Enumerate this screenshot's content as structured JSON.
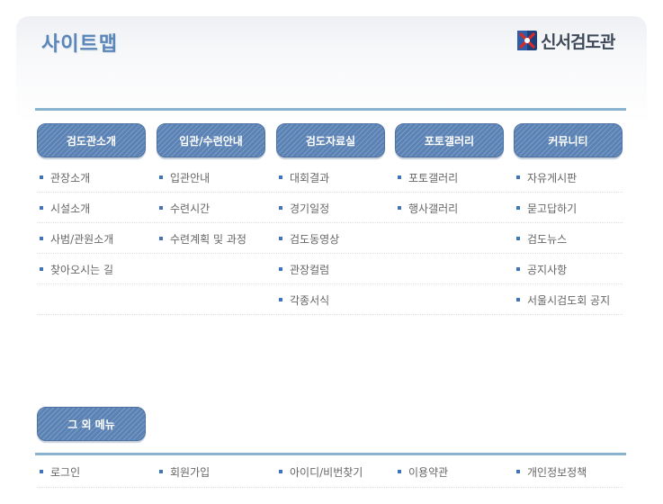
{
  "header": {
    "title": "사이트맵",
    "logo_text": "신서검도관",
    "logo_icon": "sinseo-emblem-icon"
  },
  "colors": {
    "accent": "#5b82b4",
    "title": "#5a86b8",
    "divider": "#8ab3cf",
    "bullet": "#3f74b8"
  },
  "categories": [
    {
      "label": "검도관소개",
      "items": [
        "관장소개",
        "시설소개",
        "사범/관원소개",
        "찾아오시는 길"
      ]
    },
    {
      "label": "입관/수련안내",
      "items": [
        "입관안내",
        "수련시간",
        "수련계획 및 과정"
      ]
    },
    {
      "label": "검도자료실",
      "items": [
        "대회결과",
        "경기일정",
        "검도동영상",
        "관장컬럼",
        "각종서식"
      ]
    },
    {
      "label": "포토갤러리",
      "items": [
        "포토갤러리",
        "행사갤러리"
      ]
    },
    {
      "label": "커뮤니티",
      "items": [
        "자유게시판",
        "묻고답하기",
        "검도뉴스",
        "공지사항",
        "서울시검도회 공지"
      ]
    }
  ],
  "other": {
    "label": "그 외 메뉴",
    "items": [
      "로그인",
      "회원가입",
      "아이디/비번찾기",
      "이용약관",
      "개인정보정책"
    ]
  }
}
